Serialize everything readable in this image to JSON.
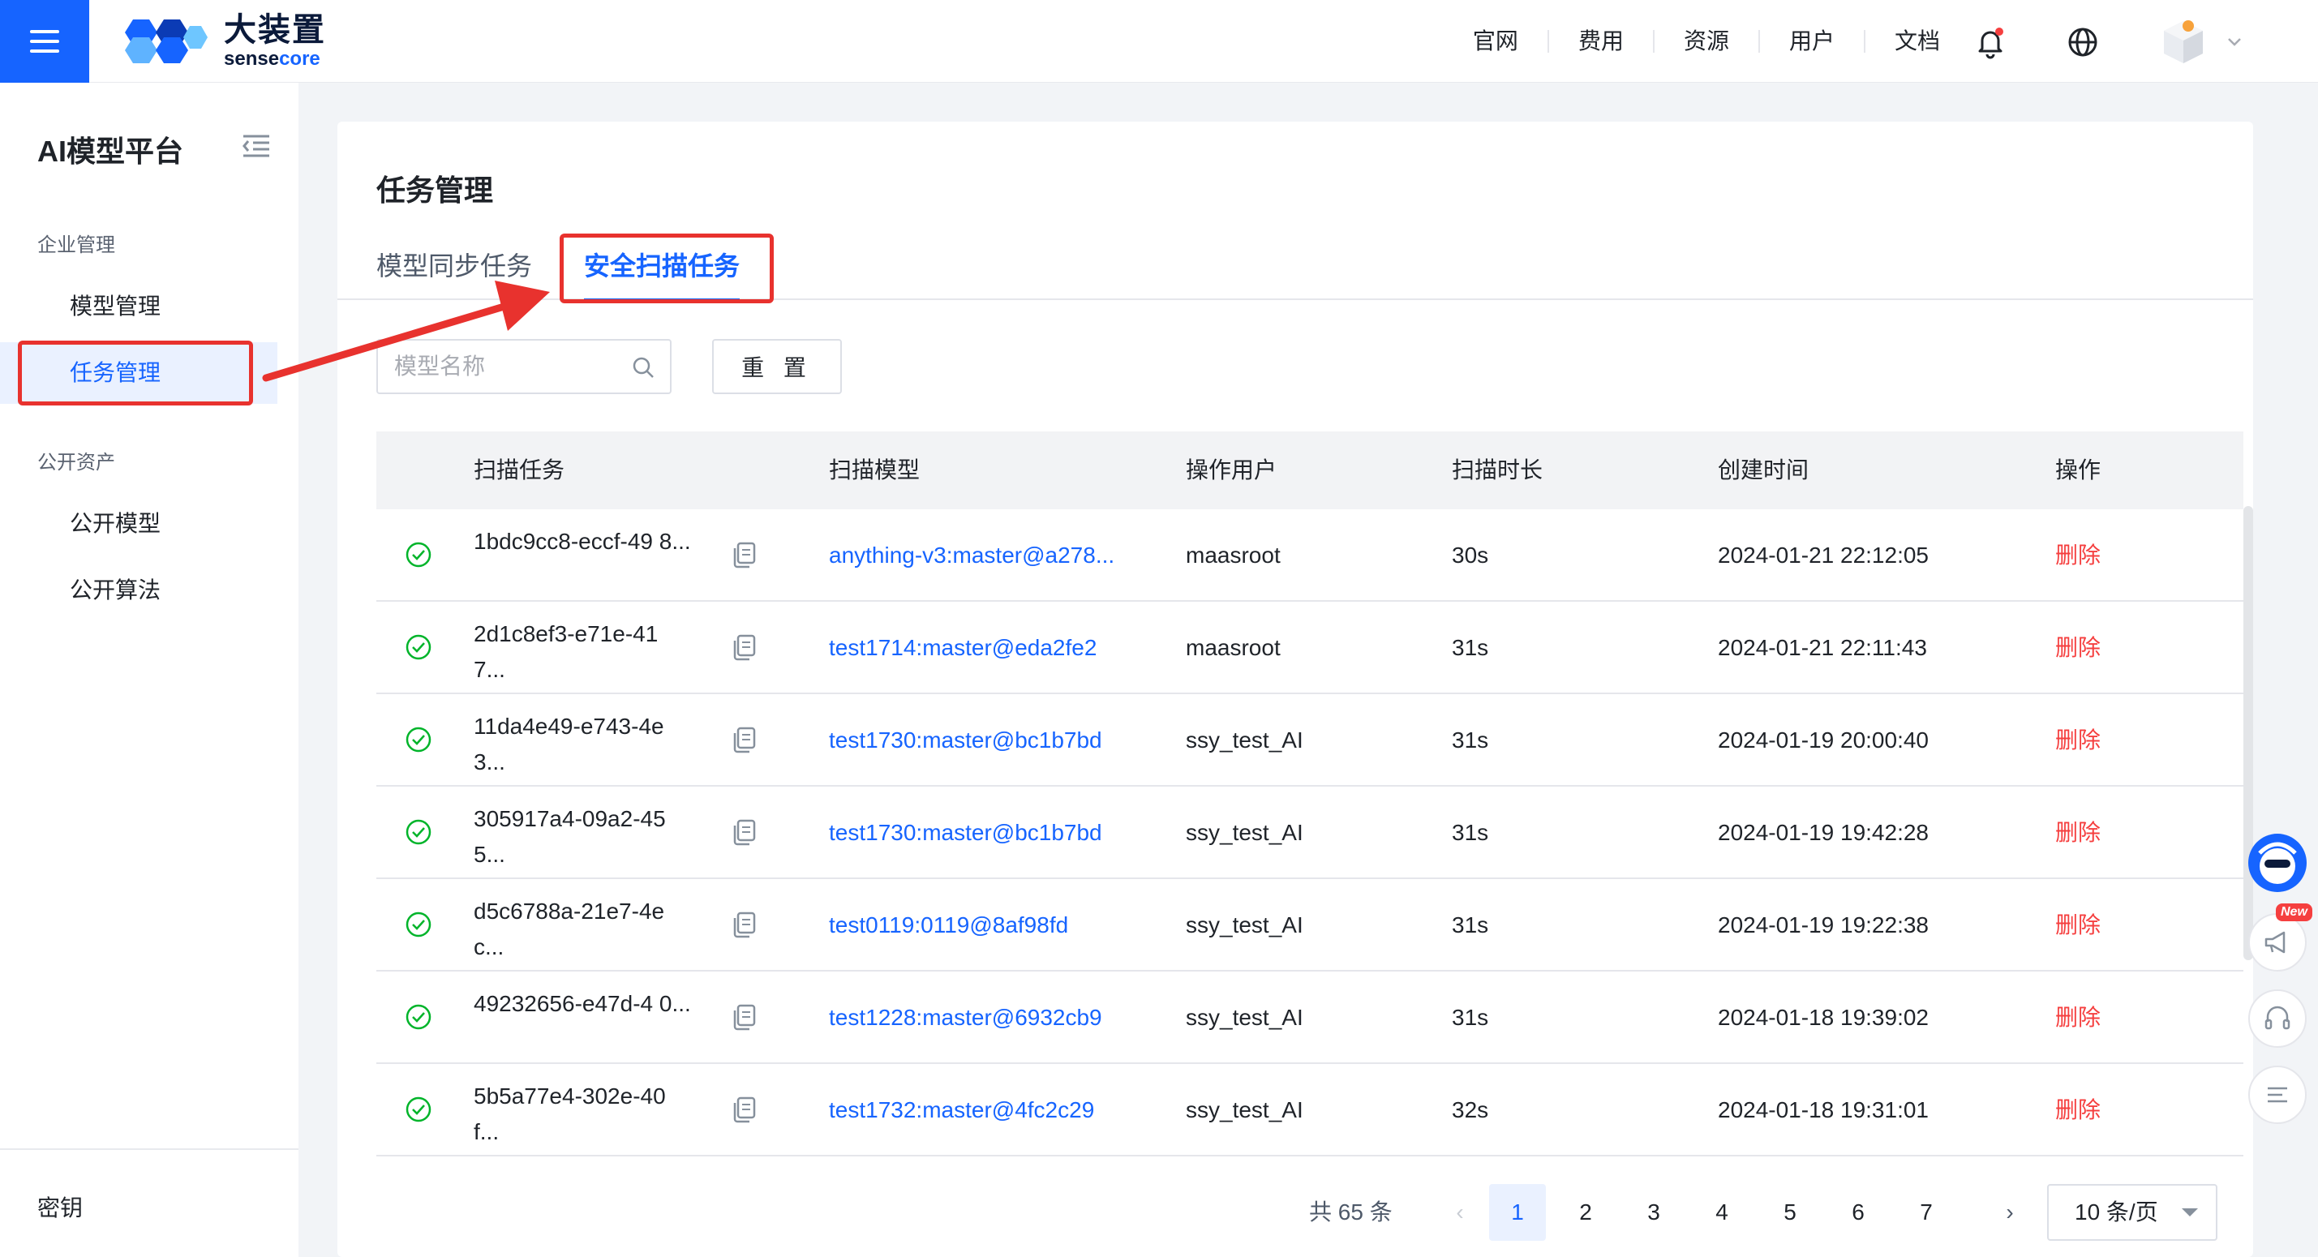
{
  "brand": {
    "name_cn": "大装置",
    "name_en_prefix": "sense",
    "name_en_suffix": "core"
  },
  "top_nav": [
    "官网",
    "费用",
    "资源",
    "用户",
    "文档"
  ],
  "sidebar": {
    "title": "AI模型平台",
    "groups": [
      {
        "label": "企业管理",
        "items": [
          "模型管理",
          "任务管理"
        ]
      },
      {
        "label": "公开资产",
        "items": [
          "公开模型",
          "公开算法"
        ]
      }
    ],
    "active_item": "任务管理",
    "bottom": "密钥"
  },
  "page": {
    "title": "任务管理",
    "tabs": [
      "模型同步任务",
      "安全扫描任务"
    ],
    "active_tab": "安全扫描任务"
  },
  "filters": {
    "search_placeholder": "模型名称",
    "reset_label": "重 置"
  },
  "table": {
    "columns": [
      "扫描任务",
      "扫描模型",
      "操作用户",
      "扫描时长",
      "创建时间",
      "操作"
    ],
    "rows": [
      {
        "task": "1bdc9cc8-eccf-49 8...",
        "model": "anything-v3:master@a278...",
        "user": "maasroot",
        "duration": "30s",
        "created": "2024-01-21 22:12:05",
        "action": "删除"
      },
      {
        "task": "2d1c8ef3-e71e-41 7...",
        "model": "test1714:master@eda2fe2",
        "user": "maasroot",
        "duration": "31s",
        "created": "2024-01-21 22:11:43",
        "action": "删除"
      },
      {
        "task": "11da4e49-e743-4e 3...",
        "model": "test1730:master@bc1b7bd",
        "user": "ssy_test_AI",
        "duration": "31s",
        "created": "2024-01-19 20:00:40",
        "action": "删除"
      },
      {
        "task": "305917a4-09a2-45 5...",
        "model": "test1730:master@bc1b7bd",
        "user": "ssy_test_AI",
        "duration": "31s",
        "created": "2024-01-19 19:42:28",
        "action": "删除"
      },
      {
        "task": "d5c6788a-21e7-4e c...",
        "model": "test0119:0119@8af98fd",
        "user": "ssy_test_AI",
        "duration": "31s",
        "created": "2024-01-19 19:22:38",
        "action": "删除"
      },
      {
        "task": "49232656-e47d-4 0...",
        "model": "test1228:master@6932cb9",
        "user": "ssy_test_AI",
        "duration": "31s",
        "created": "2024-01-18 19:39:02",
        "action": "删除"
      },
      {
        "task": "5b5a77e4-302e-40 f...",
        "model": "test1732:master@4fc2c29",
        "user": "ssy_test_AI",
        "duration": "32s",
        "created": "2024-01-18 19:31:01",
        "action": "删除"
      }
    ]
  },
  "pagination": {
    "total": "共 65 条",
    "pages": [
      "1",
      "2",
      "3",
      "4",
      "5",
      "6",
      "7"
    ],
    "current": "1",
    "page_size": "10 条/页"
  },
  "floating": {
    "new_badge": "New"
  },
  "colors": {
    "primary": "#1664ff",
    "danger": "#f53f3f",
    "success": "#00b42a",
    "annotation": "#e8322e"
  }
}
